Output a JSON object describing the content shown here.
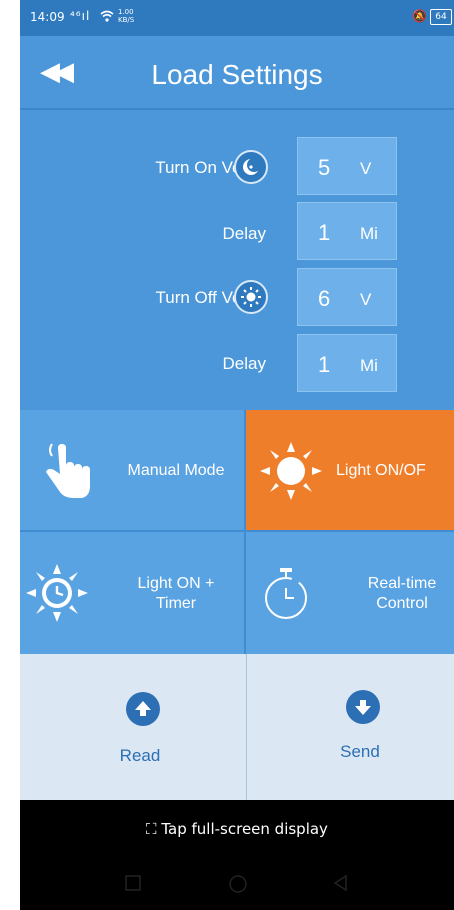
{
  "status_bar": {
    "time": "14:09",
    "signal": "⁴⁶ıl",
    "wifi_icon": "wifi-icon",
    "rate_top": "1.00",
    "rate_bottom": "KB/S",
    "mute_icon": "mute-icon",
    "battery": "64"
  },
  "header": {
    "back_icon": "rewind-back-icon",
    "title": "Load Settings"
  },
  "settings": {
    "turn_on_volt": {
      "label": "Turn On Volt",
      "icon": "moon-icon",
      "value": "5",
      "unit": "V"
    },
    "turn_on_delay": {
      "label": "Delay",
      "value": "1",
      "unit": "Mi"
    },
    "turn_off_volt": {
      "label": "Turn Off Volt",
      "icon": "sun-icon",
      "value": "6",
      "unit": "V"
    },
    "turn_off_delay": {
      "label": "Delay",
      "value": "1",
      "unit": "Mi"
    }
  },
  "modes": {
    "manual": {
      "label": "Manual Mode",
      "icon": "hand-tap-icon"
    },
    "light_on_off": {
      "label": "Light ON/OF",
      "icon": "sun-icon",
      "active": true
    },
    "light_timer": {
      "label_line1": "Light ON +",
      "label_line2": "Timer",
      "icon": "sun-clock-icon"
    },
    "realtime": {
      "label_line1": "Real-time",
      "label_line2": "Control",
      "icon": "stopwatch-icon"
    }
  },
  "actions": {
    "read": {
      "label": "Read",
      "icon": "arrow-up-circle-icon"
    },
    "send": {
      "label": "Send",
      "icon": "arrow-down-circle-icon"
    }
  },
  "fullscreen": {
    "label": "Tap full-screen display",
    "icon": "expand-icon"
  },
  "colors": {
    "header": "#4b97d9",
    "active_mode": "#ef7e2b",
    "action_bg": "#dbe8f3",
    "action_accent": "#2d6fb4"
  }
}
